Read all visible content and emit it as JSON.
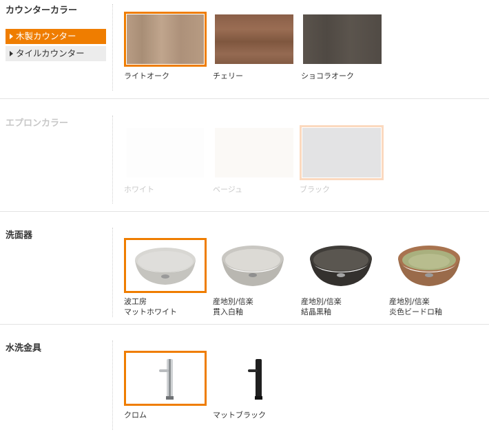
{
  "counter": {
    "title": "カウンターカラー",
    "tabs": [
      {
        "label": "木製カウンター",
        "active": true
      },
      {
        "label": "タイルカウンター",
        "active": false
      }
    ],
    "options": [
      {
        "label": "ライトオーク",
        "selected": true
      },
      {
        "label": "チェリー",
        "selected": false
      },
      {
        "label": "ショコラオーク",
        "selected": false
      }
    ]
  },
  "apron": {
    "title": "エプロンカラー",
    "options": [
      {
        "label": "ホワイト"
      },
      {
        "label": "ベージュ"
      },
      {
        "label": "ブラック"
      }
    ]
  },
  "basin": {
    "title": "洗面器",
    "options": [
      {
        "line1": "波工房",
        "line2": "マットホワイト",
        "selected": true
      },
      {
        "line1": "産地別/信楽",
        "line2": "貫入白釉",
        "selected": false
      },
      {
        "line1": "産地別/信楽",
        "line2": "結晶黒釉",
        "selected": false
      },
      {
        "line1": "産地別/信楽",
        "line2": "炎色ビードロ釉",
        "selected": false
      }
    ]
  },
  "faucet": {
    "title": "水洗金具",
    "options": [
      {
        "label": "クロム",
        "selected": true
      },
      {
        "label": "マットブラック",
        "selected": false
      }
    ]
  },
  "colors": {
    "accent": "#ef7d00",
    "light_oak": "#b69a81",
    "cherry": "#8c6049",
    "chocolate_oak": "#565049"
  }
}
